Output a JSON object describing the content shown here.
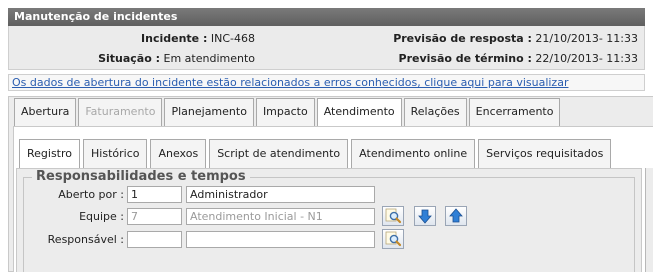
{
  "header": {
    "title": "Manutenção de incidentes"
  },
  "info": {
    "incident_label": "Incidente :",
    "incident_value": "INC-468",
    "status_label": "Situação :",
    "status_value": "Em atendimento",
    "response_label": "Previsão de resposta :",
    "response_value": "21/10/2013- 11:33",
    "end_label": "Previsão de término :",
    "end_value": "22/10/2013- 11:33"
  },
  "notice": {
    "text": "Os dados de abertura do incidente estão relacionados a erros conhecidos, clique aqui para visualizar"
  },
  "main_tabs": [
    {
      "label": "Abertura"
    },
    {
      "label": "Faturamento"
    },
    {
      "label": "Planejamento"
    },
    {
      "label": "Impacto"
    },
    {
      "label": "Atendimento"
    },
    {
      "label": "Relações"
    },
    {
      "label": "Encerramento"
    }
  ],
  "sub_tabs": [
    {
      "label": "Registro"
    },
    {
      "label": "Histórico"
    },
    {
      "label": "Anexos"
    },
    {
      "label": "Script de atendimento"
    },
    {
      "label": "Atendimento online"
    },
    {
      "label": "Serviços requisitados"
    }
  ],
  "section": {
    "title": "Responsabilidades e tempos"
  },
  "form": {
    "opened_by_label": "Aberto por :",
    "opened_by_code": "1",
    "opened_by_name": "Administrador",
    "team_label": "Equipe :",
    "team_code": "7",
    "team_name": "Atendimento Inicial - N1",
    "responsible_label": "Responsável :",
    "responsible_code": "",
    "responsible_name": ""
  },
  "icons": {
    "search": "search-icon",
    "down": "arrow-down-icon",
    "up": "arrow-up-icon"
  },
  "colors": {
    "header_bg": "#666666",
    "link": "#2a5db0",
    "arrow_blue": "#2f7fd6"
  }
}
